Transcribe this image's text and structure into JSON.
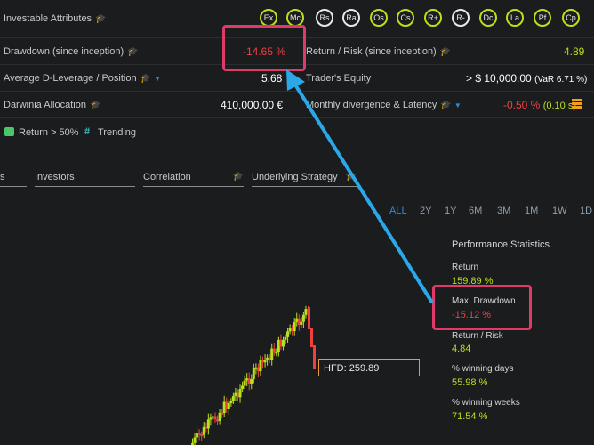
{
  "attributes": {
    "label": "Investable Attributes",
    "badges": [
      "Ex",
      "Mc",
      "Rs",
      "Ra",
      "Os",
      "Cs",
      "R+",
      "R-",
      "Dc",
      "La",
      "Pf",
      "Cp"
    ]
  },
  "drawdown": {
    "label": "Drawdown (since inception)",
    "value": "-14.65 %"
  },
  "return_risk": {
    "label": "Return / Risk (since inception)",
    "value": "4.89"
  },
  "leverage": {
    "label": "Average D-Leverage / Position",
    "value": "5.68"
  },
  "equity": {
    "label": "Trader's Equity",
    "value": "> $ 10,000.00",
    "var": "(VaR 6.71 %)"
  },
  "allocation": {
    "label": "Darwinia Allocation",
    "value": "410,000.00 €"
  },
  "divergence": {
    "label": "Monthly divergence & Latency",
    "value": "-0.50 %",
    "latency": "(0.10 s)"
  },
  "tags": [
    {
      "label": "Return > 50%",
      "icon": "return-badge-icon"
    },
    {
      "label": "Trending",
      "icon": "trending-hash-icon"
    }
  ],
  "tabs": [
    "s",
    "Investors",
    "Correlation",
    "Underlying Strategy"
  ],
  "periods": [
    "ALL",
    "2Y",
    "1Y",
    "6M",
    "3M",
    "1M",
    "1W",
    "1D"
  ],
  "active_period": "ALL",
  "perf": {
    "title": "Performance Statistics",
    "return_label": "Return",
    "return_value": "159.89 %",
    "maxdd_label": "Max. Drawdown",
    "maxdd_value": "-15.12 %",
    "rr_label": "Return / Risk",
    "rr_value": "4.84",
    "wdays_label": "% winning days",
    "wdays_value": "55.98 %",
    "wweeks_label": "% winning weeks",
    "wweeks_value": "71.54 %"
  },
  "hfd_label": "HFD: 259.89",
  "colors": {
    "green": "#b7e11a",
    "red": "#ef4040",
    "blue": "#2b8de0",
    "highlight": "#e03a6b"
  }
}
